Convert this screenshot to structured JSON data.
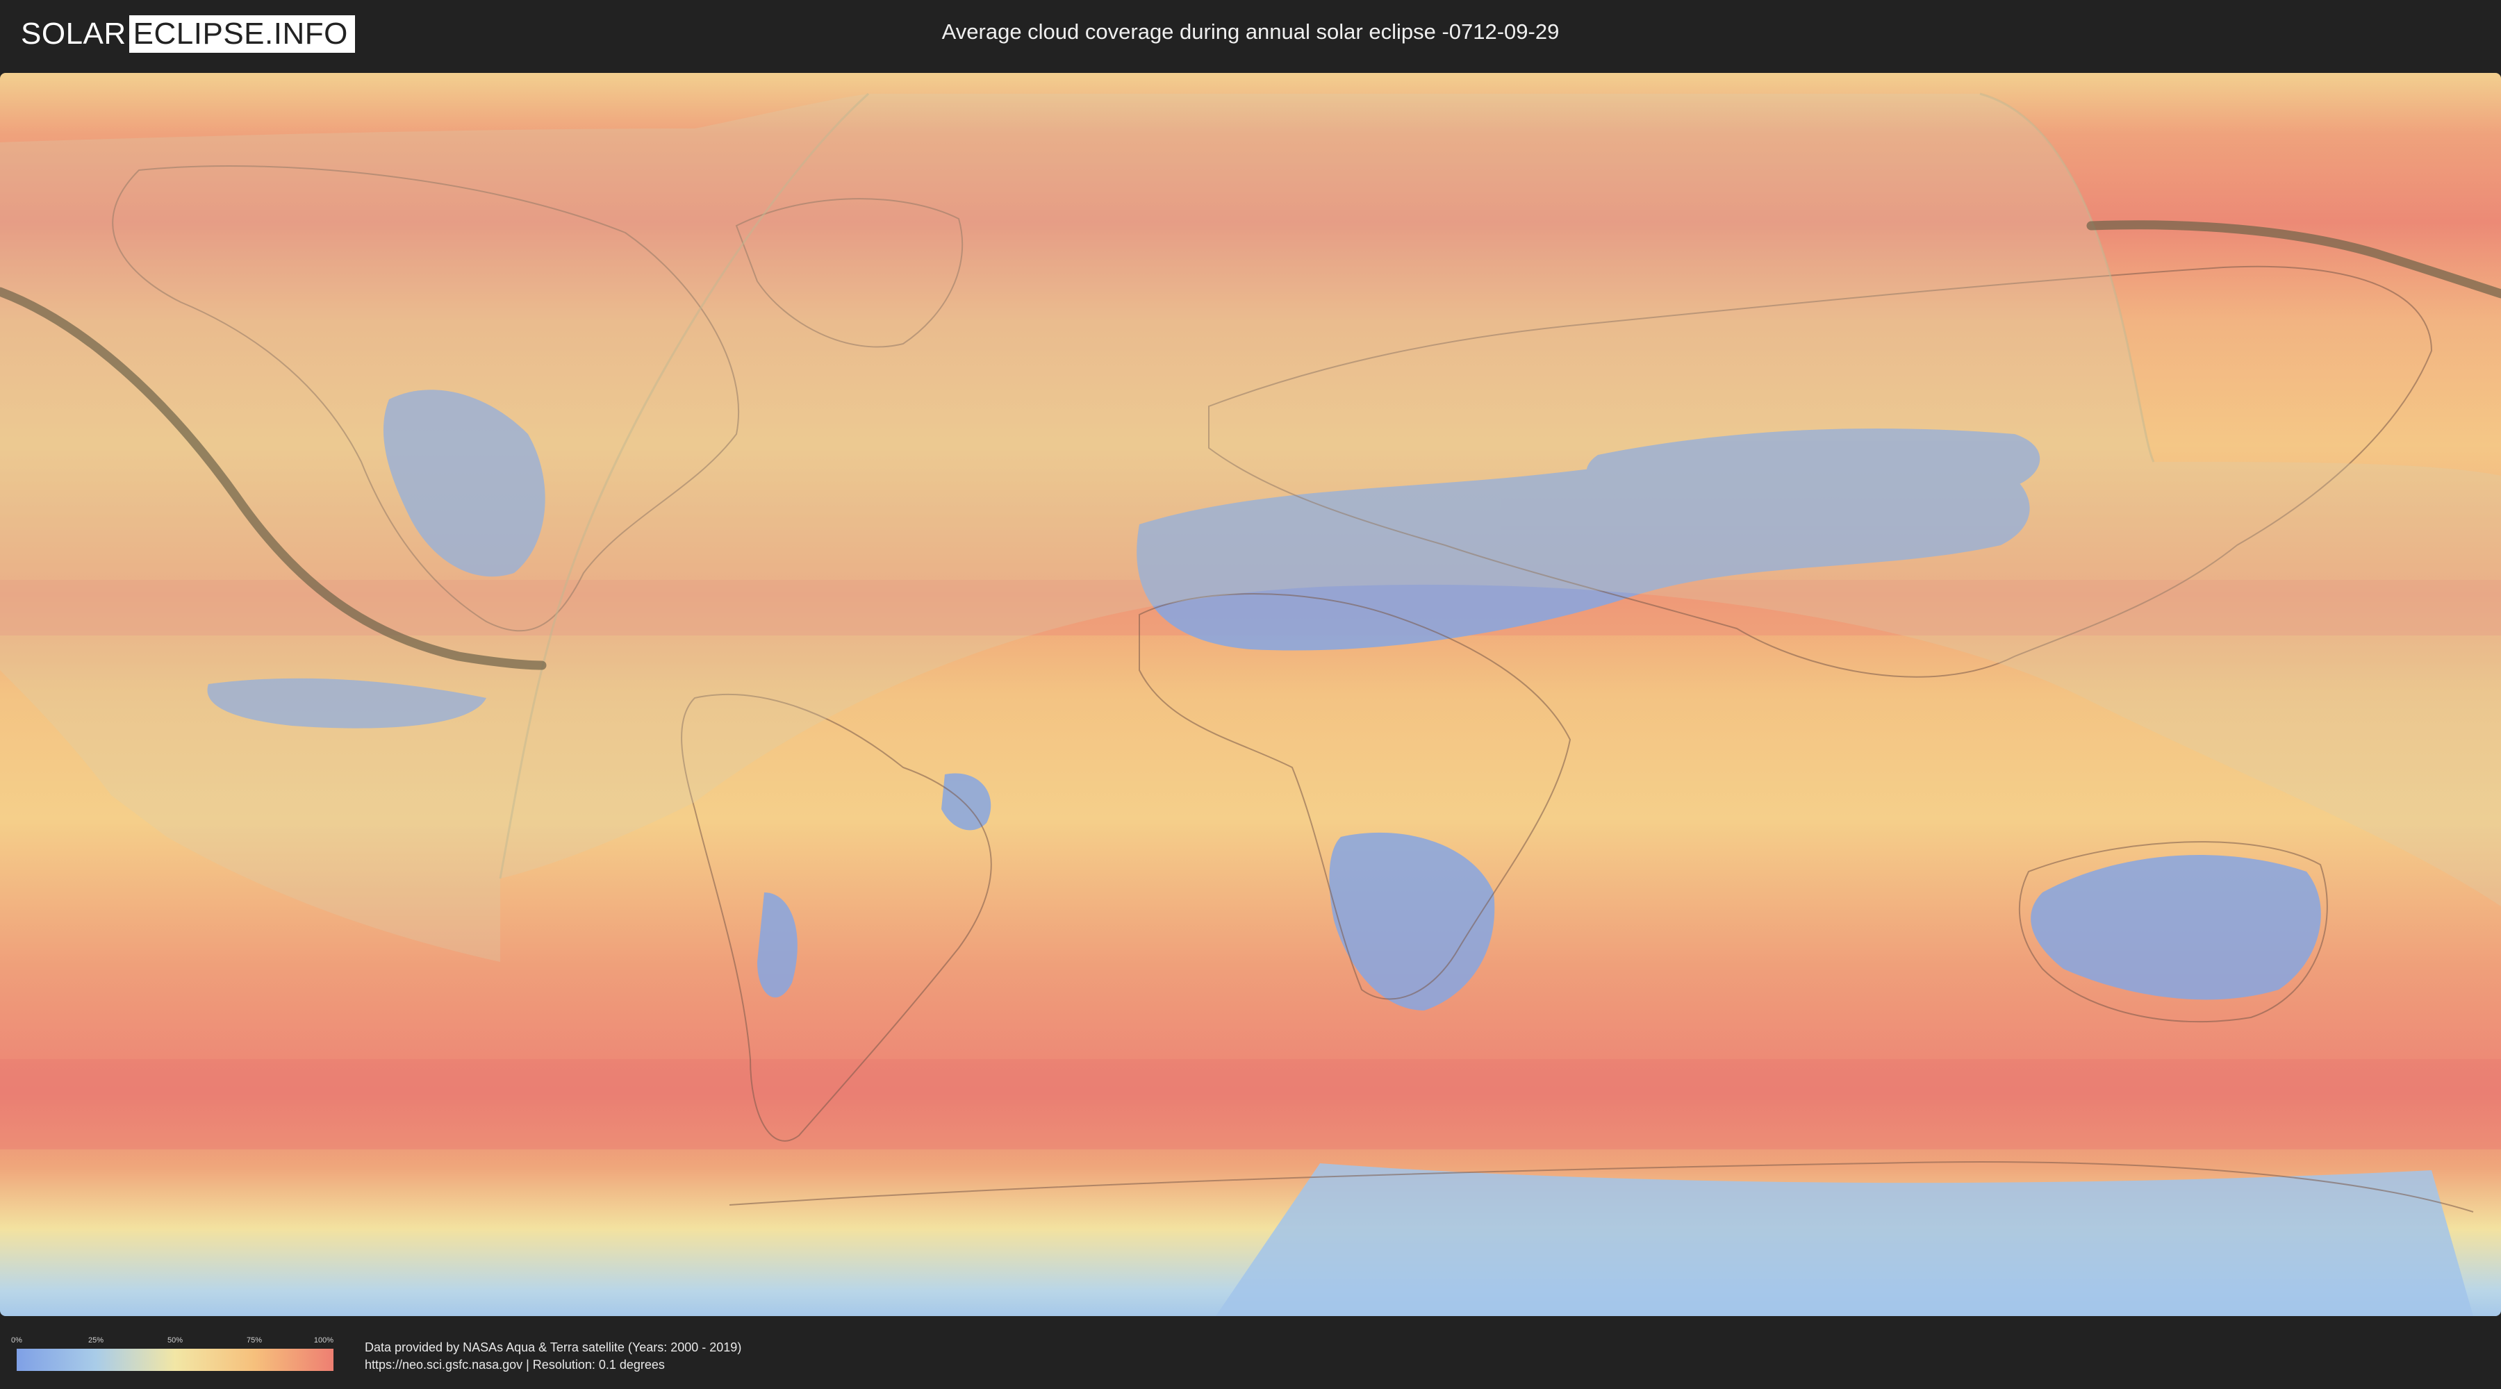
{
  "header": {
    "logo_left": "SOLAR",
    "logo_right": "ECLIPSE.INFO",
    "title": "Average cloud coverage during annual solar eclipse -0712-09-29"
  },
  "map": {
    "projection": "equirectangular",
    "layer": "average cloud coverage",
    "eclipse_type": "annular",
    "date": "-0712-09-29"
  },
  "legend": {
    "ticks": [
      "0%",
      "25%",
      "50%",
      "75%",
      "100%"
    ],
    "colors": [
      "#7fa0e6",
      "#a9cce8",
      "#f2e6a5",
      "#f6c07c",
      "#ee7f72"
    ]
  },
  "credits": {
    "line1": "Data provided by NASAs Aqua & Terra satellite (Years: 2000 - 2019)",
    "line2": "https://neo.sci.gsfc.nasa.gov | Resolution: 0.1 degrees"
  }
}
